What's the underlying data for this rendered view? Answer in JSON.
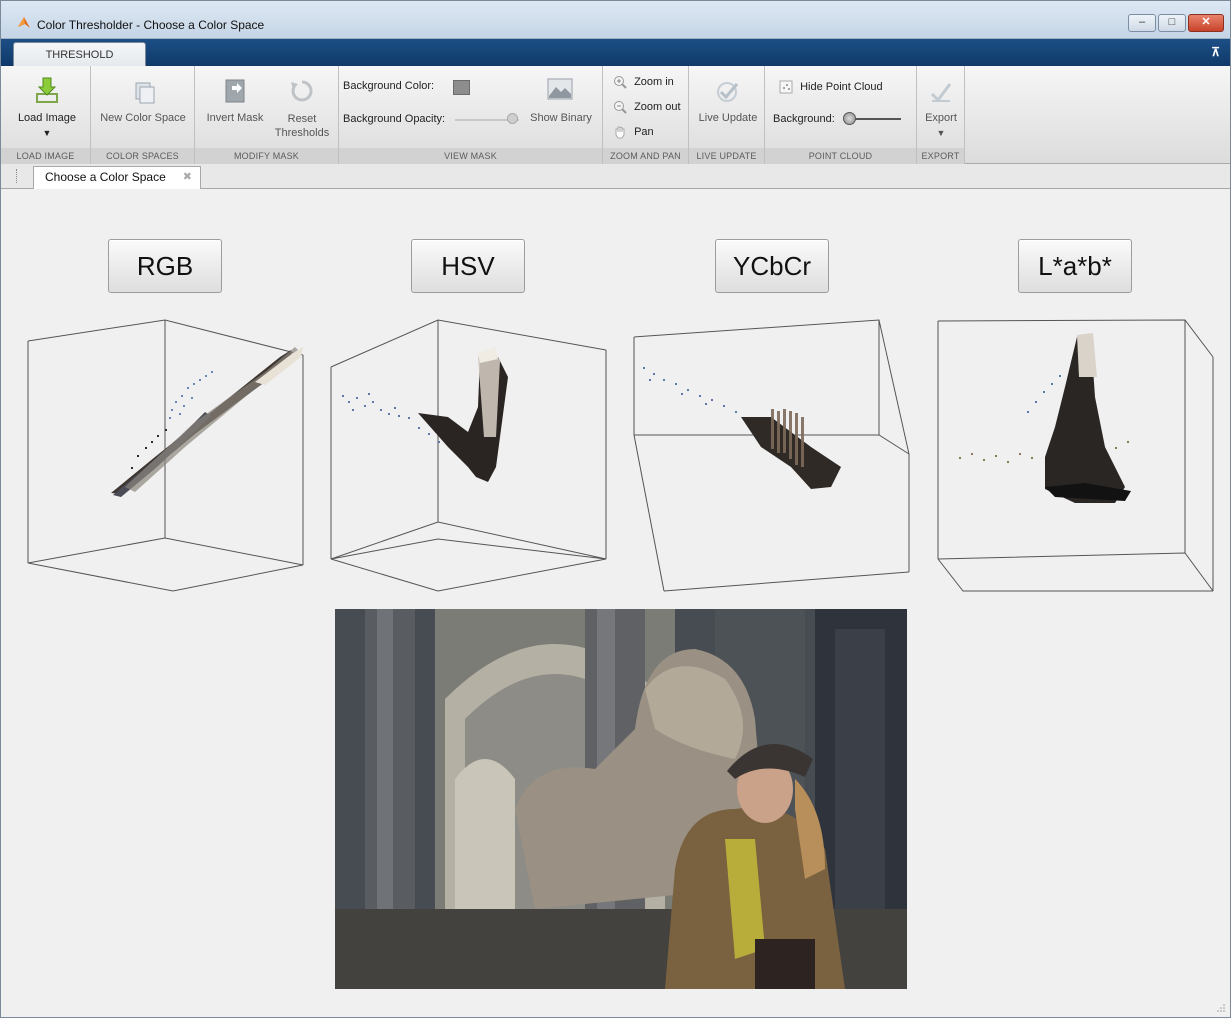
{
  "window": {
    "title": "Color Thresholder - Choose a Color Space",
    "controls": [
      "minimize-icon",
      "maximize-icon",
      "close-icon"
    ]
  },
  "toolstrip": {
    "tab": "THRESHOLD",
    "sections": {
      "load_image": {
        "label": "LOAD IMAGE",
        "load_button": "Load Image"
      },
      "color_spaces": {
        "label": "COLOR SPACES",
        "new_button": "New Color Space"
      },
      "modify_mask": {
        "label": "MODIFY MASK",
        "invert_button": "Invert Mask",
        "reset_button_line1": "Reset",
        "reset_button_line2": "Thresholds"
      },
      "view_mask": {
        "label": "VIEW MASK",
        "background_color_label": "Background Color:",
        "background_opacity_label": "Background Opacity:",
        "show_binary_button": "Show Binary"
      },
      "zoom_pan": {
        "label": "ZOOM AND PAN",
        "zoom_in": "Zoom in",
        "zoom_out": "Zoom out",
        "pan": "Pan"
      },
      "live_update": {
        "label": "LIVE UPDATE",
        "button": "Live Update"
      },
      "point_cloud": {
        "label": "POINT CLOUD",
        "hide_button": "Hide Point Cloud",
        "background_label": "Background:"
      },
      "export": {
        "label": "EXPORT",
        "button": "Export"
      }
    }
  },
  "document_tab": {
    "label": "Choose a Color Space"
  },
  "color_space_buttons": [
    "RGB",
    "HSV",
    "YCbCr",
    "L*a*b*"
  ],
  "colors": {
    "title_bar": "#c5d5e6",
    "tab_bar": "#0f3868",
    "content_bg": "#f0f0f0"
  }
}
